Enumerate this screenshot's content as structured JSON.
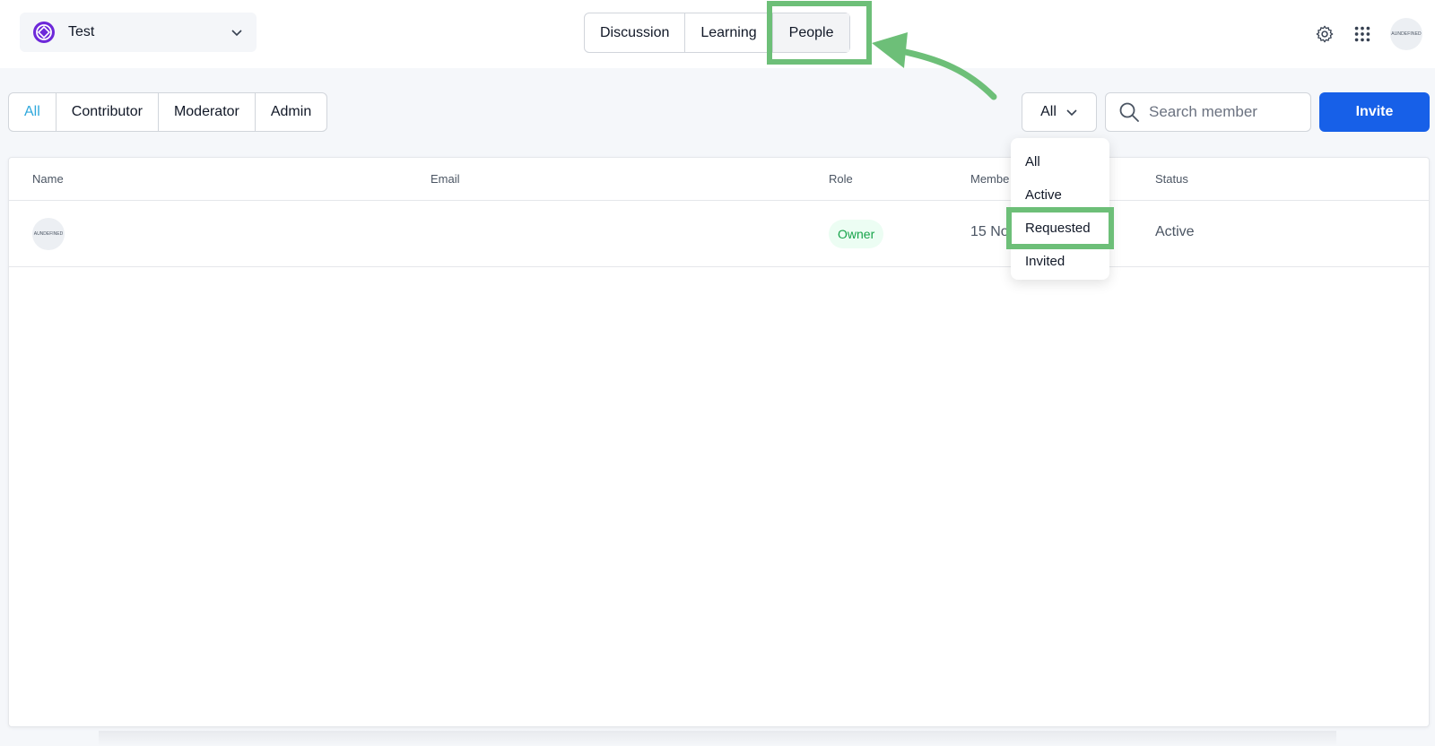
{
  "workspace": {
    "name": "Test"
  },
  "main_tabs": [
    {
      "label": "Discussion"
    },
    {
      "label": "Learning"
    },
    {
      "label": "People"
    }
  ],
  "user": {
    "avatar_text": "AUNDEFINED"
  },
  "role_tabs": [
    {
      "label": "All"
    },
    {
      "label": "Contributor"
    },
    {
      "label": "Moderator"
    },
    {
      "label": "Admin"
    }
  ],
  "status_filter": {
    "selected": "All",
    "options": [
      "All",
      "Active",
      "Requested",
      "Invited"
    ]
  },
  "search": {
    "placeholder": "Search member"
  },
  "invite_label": "Invite",
  "table": {
    "columns": [
      "Name",
      "Email",
      "Role",
      "Membe",
      "Status"
    ],
    "rows": [
      {
        "avatar_text": "AUNDEFINED",
        "email": "",
        "role": "Owner",
        "member_since": "15 No",
        "status": "Active"
      }
    ]
  },
  "colors": {
    "accent": "#1760e8",
    "active_tab": "#2ea8dc",
    "highlight": "#6dbf78",
    "owner_badge_text": "#16a34a"
  }
}
